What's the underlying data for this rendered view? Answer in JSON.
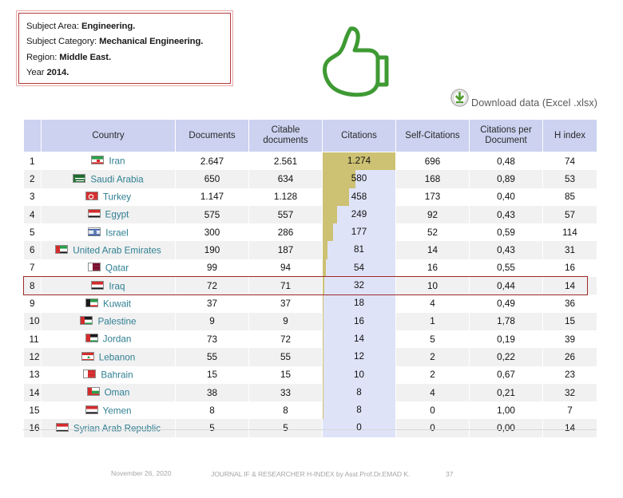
{
  "info_box": {
    "lines": [
      {
        "label": "Subject Area: ",
        "value": "Engineering."
      },
      {
        "label": "Subject Category: ",
        "value": "Mechanical Engineering."
      },
      {
        "label": "Region: ",
        "value": "Middle East."
      },
      {
        "label": "Year ",
        "value": "2014."
      }
    ]
  },
  "graphic": {
    "icon": "thumbs-up-icon",
    "color": "#3e9a33"
  },
  "download": {
    "icon": "download-circle-icon",
    "label": "Download data (Excel .xlsx)",
    "icon_color": "#4f9b2f"
  },
  "table": {
    "headers": [
      "",
      "Country",
      "Documents",
      "Citable documents",
      "Citations",
      "Self-Citations",
      "Citations per Document",
      "H index"
    ],
    "header_bg": "#ccd2f0",
    "citation_bar_color": "#cdc173",
    "citation_cell_bg": "#dfe3f8",
    "citations_max": 1274,
    "rows": [
      {
        "rank": "1",
        "country": "Iran",
        "documents": "2.647",
        "citable": "2.561",
        "citations": "1.274",
        "citations_num": 1274,
        "self_citations": "696",
        "cpd": "0,48",
        "h_index": "74",
        "flag": "flag-iran"
      },
      {
        "rank": "2",
        "country": "Saudi Arabia",
        "documents": "650",
        "citable": "634",
        "citations": "580",
        "citations_num": 580,
        "self_citations": "168",
        "cpd": "0,89",
        "h_index": "53",
        "flag": "flag-saudi-arabia"
      },
      {
        "rank": "3",
        "country": "Turkey",
        "documents": "1.147",
        "citable": "1.128",
        "citations": "458",
        "citations_num": 458,
        "self_citations": "173",
        "cpd": "0,40",
        "h_index": "85",
        "flag": "flag-turkey"
      },
      {
        "rank": "4",
        "country": "Egypt",
        "documents": "575",
        "citable": "557",
        "citations": "249",
        "citations_num": 249,
        "self_citations": "92",
        "cpd": "0,43",
        "h_index": "57",
        "flag": "flag-egypt"
      },
      {
        "rank": "5",
        "country": "Israel",
        "documents": "300",
        "citable": "286",
        "citations": "177",
        "citations_num": 177,
        "self_citations": "52",
        "cpd": "0,59",
        "h_index": "114",
        "flag": "flag-israel"
      },
      {
        "rank": "6",
        "country": "United Arab Emirates",
        "documents": "190",
        "citable": "187",
        "citations": "81",
        "citations_num": 81,
        "self_citations": "14",
        "cpd": "0,43",
        "h_index": "31",
        "flag": "flag-uae"
      },
      {
        "rank": "7",
        "country": "Qatar",
        "documents": "99",
        "citable": "94",
        "citations": "54",
        "citations_num": 54,
        "self_citations": "16",
        "cpd": "0,55",
        "h_index": "16",
        "flag": "flag-qatar"
      },
      {
        "rank": "8",
        "country": "Iraq",
        "documents": "72",
        "citable": "71",
        "citations": "32",
        "citations_num": 32,
        "self_citations": "10",
        "cpd": "0,44",
        "h_index": "14",
        "flag": "flag-iraq",
        "highlighted": true
      },
      {
        "rank": "9",
        "country": "Kuwait",
        "documents": "37",
        "citable": "37",
        "citations": "18",
        "citations_num": 18,
        "self_citations": "4",
        "cpd": "0,49",
        "h_index": "36",
        "flag": "flag-kuwait"
      },
      {
        "rank": "10",
        "country": "Palestine",
        "documents": "9",
        "citable": "9",
        "citations": "16",
        "citations_num": 16,
        "self_citations": "1",
        "cpd": "1,78",
        "h_index": "15",
        "flag": "flag-palestine"
      },
      {
        "rank": "11",
        "country": "Jordan",
        "documents": "73",
        "citable": "72",
        "citations": "14",
        "citations_num": 14,
        "self_citations": "5",
        "cpd": "0,19",
        "h_index": "39",
        "flag": "flag-jordan"
      },
      {
        "rank": "12",
        "country": "Lebanon",
        "documents": "55",
        "citable": "55",
        "citations": "12",
        "citations_num": 12,
        "self_citations": "2",
        "cpd": "0,22",
        "h_index": "26",
        "flag": "flag-lebanon"
      },
      {
        "rank": "13",
        "country": "Bahrain",
        "documents": "15",
        "citable": "15",
        "citations": "10",
        "citations_num": 10,
        "self_citations": "2",
        "cpd": "0,67",
        "h_index": "23",
        "flag": "flag-bahrain"
      },
      {
        "rank": "14",
        "country": "Oman",
        "documents": "38",
        "citable": "33",
        "citations": "8",
        "citations_num": 8,
        "self_citations": "4",
        "cpd": "0,21",
        "h_index": "32",
        "flag": "flag-oman"
      },
      {
        "rank": "15",
        "country": "Yemen",
        "documents": "8",
        "citable": "8",
        "citations": "8",
        "citations_num": 8,
        "self_citations": "0",
        "cpd": "1,00",
        "h_index": "7",
        "flag": "flag-yemen"
      },
      {
        "rank": "16",
        "country": "Syrian Arab Republic",
        "documents": "5",
        "citable": "5",
        "citations": "0",
        "citations_num": 0,
        "self_citations": "0",
        "cpd": "0,00",
        "h_index": "14",
        "flag": "flag-syria"
      }
    ]
  },
  "highlight": {
    "color": "#9e2a2a",
    "target_row": "Iraq"
  },
  "footer": {
    "date": "November 26, 2020",
    "center": "JOURNAL IF & RESEARCHER H-INDEX by Asst.Prof.Dr.EMAD K.",
    "page": "37"
  }
}
